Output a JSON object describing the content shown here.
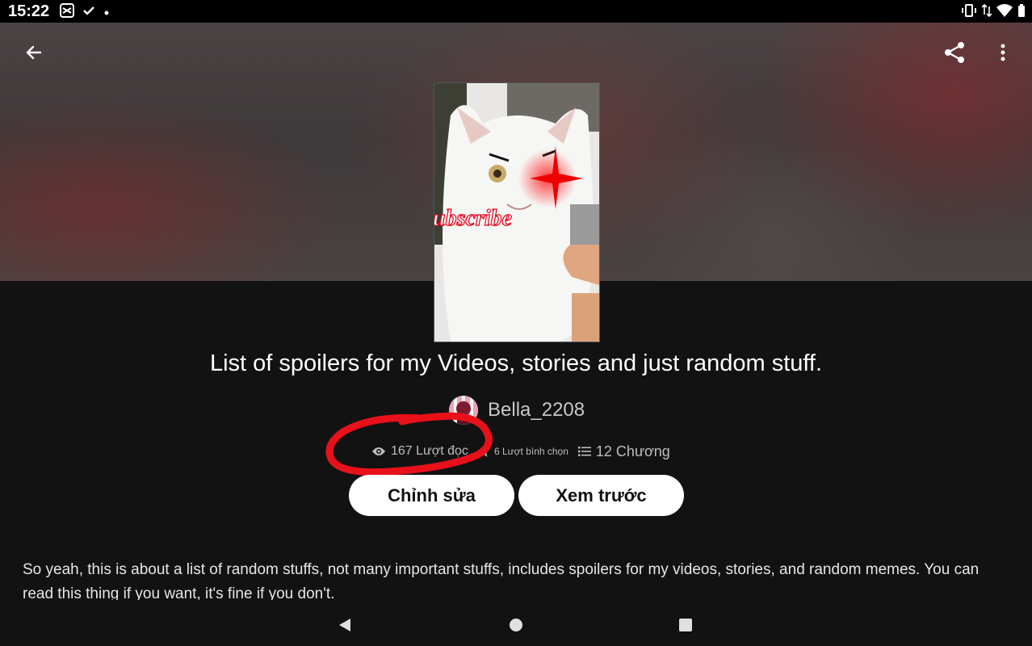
{
  "status_bar": {
    "time": "15:22",
    "left_icons": [
      "capcut-icon",
      "check-icon",
      "dot-icon"
    ],
    "right_icons": [
      "vibrate-icon",
      "data-arrows-icon",
      "wifi-icon",
      "battery-icon"
    ]
  },
  "header": {
    "back_icon": "arrow-left-icon",
    "share_icon": "share-icon",
    "more_icon": "more-vertical-icon"
  },
  "story": {
    "cover_text": "Subscribe",
    "title": "List of spoilers for my Videos, stories and just random stuff.",
    "author": "Bella_2208",
    "stats": {
      "reads": "167 Lượt đọc",
      "votes": "6 Lượt bình chọn",
      "parts": "12 Chương"
    },
    "edit_label": "Chỉnh sửa",
    "preview_label": "Xem trước",
    "description": "So yeah, this is about a list of random stuffs, not many important stuffs, includes spoilers for my videos, stories, and random memes. You can read this thing if you want, it's fine if you don't."
  },
  "colors": {
    "background": "#121212",
    "button_bg": "#ffffff",
    "annotation_red": "#e8101a",
    "muted_text": "#bdbdbd"
  },
  "nav_bar": {
    "icons": [
      "nav-back-icon",
      "nav-home-icon",
      "nav-recents-icon"
    ]
  }
}
